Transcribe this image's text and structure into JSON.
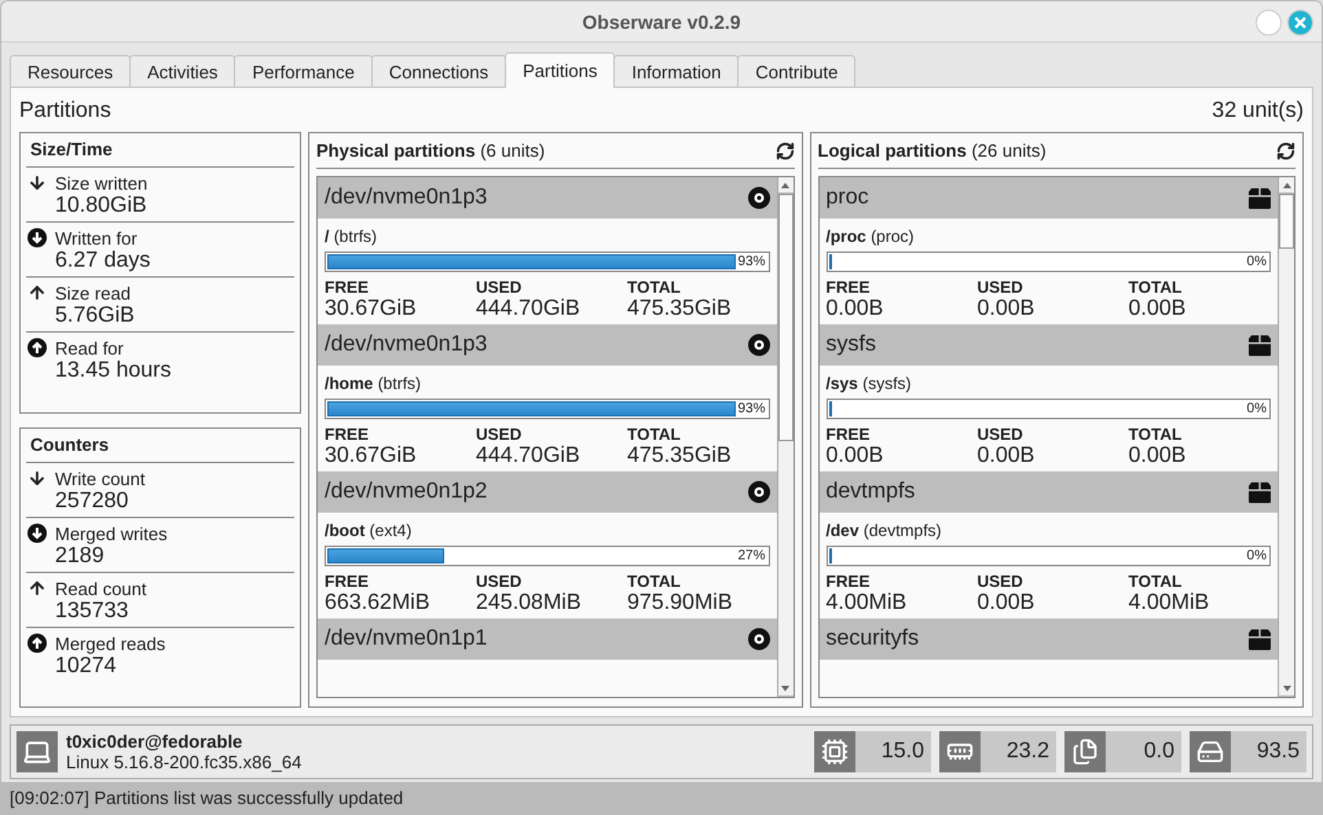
{
  "window": {
    "title": "Obserware v0.2.9"
  },
  "tabs": [
    {
      "label": "Resources",
      "selected": false
    },
    {
      "label": "Activities",
      "selected": false
    },
    {
      "label": "Performance",
      "selected": false
    },
    {
      "label": "Connections",
      "selected": false
    },
    {
      "label": "Partitions",
      "selected": true
    },
    {
      "label": "Information",
      "selected": false
    },
    {
      "label": "Contribute",
      "selected": false
    }
  ],
  "page": {
    "title": "Partitions",
    "unit_count": "32 unit(s)"
  },
  "stat_groups": [
    {
      "title": "Size/Time",
      "items": [
        {
          "kind": "down",
          "label": "Size written",
          "value": "10.80GiB"
        },
        {
          "kind": "down-circle",
          "label": "Written for",
          "value": "6.27 days"
        },
        {
          "kind": "up",
          "label": "Size read",
          "value": "5.76GiB"
        },
        {
          "kind": "up-circle",
          "label": "Read for",
          "value": "13.45 hours"
        }
      ]
    },
    {
      "title": "Counters",
      "items": [
        {
          "kind": "down",
          "label": "Write count",
          "value": "257280"
        },
        {
          "kind": "down-circle",
          "label": "Merged writes",
          "value": "2189"
        },
        {
          "kind": "up",
          "label": "Read count",
          "value": "135733"
        },
        {
          "kind": "up-circle",
          "label": "Merged reads",
          "value": "10274"
        }
      ]
    }
  ],
  "partition_panels": [
    {
      "title": "**Physical partitions** (6 units)",
      "kind": "physical",
      "items": [
        {
          "device": "/dev/nvme0n1p3",
          "mount": "/",
          "fstype": "(btrfs)",
          "level": 0.93,
          "percent": "93%",
          "labels": [
            "FREE",
            "USED",
            "TOTAL"
          ],
          "free": "30.67GiB",
          "used": "444.70GiB",
          "total": "475.35GiB"
        },
        {
          "device": "/dev/nvme0n1p3",
          "mount": "/home",
          "fstype": "(btrfs)",
          "level": 0.93,
          "percent": "93%",
          "labels": [
            "FREE",
            "USED",
            "TOTAL"
          ],
          "free": "30.67GiB",
          "used": "444.70GiB",
          "total": "475.35GiB"
        },
        {
          "device": "/dev/nvme0n1p2",
          "mount": "/boot",
          "fstype": "(ext4)",
          "level": 0.27,
          "percent": "27%",
          "labels": [
            "FREE",
            "USED",
            "TOTAL"
          ],
          "free": "663.62MiB",
          "used": "245.08MiB",
          "total": "975.90MiB"
        },
        {
          "device": "/dev/nvme0n1p1"
        }
      ]
    },
    {
      "title": "**Logical partitions** (26 units)",
      "kind": "logical",
      "items": [
        {
          "device": "proc",
          "mount": "/proc",
          "fstype": "(proc)",
          "level": 0,
          "percent": "0%",
          "labels": [
            "FREE",
            "USED",
            "TOTAL"
          ],
          "free": "0.00B",
          "used": "0.00B",
          "total": "0.00B"
        },
        {
          "device": "sysfs",
          "mount": "/sys",
          "fstype": "(sysfs)",
          "level": 0,
          "percent": "0%",
          "labels": [
            "FREE",
            "USED",
            "TOTAL"
          ],
          "free": "0.00B",
          "used": "0.00B",
          "total": "0.00B"
        },
        {
          "device": "devtmpfs",
          "mount": "/dev",
          "fstype": "(devtmpfs)",
          "level": 0,
          "percent": "0%",
          "labels": [
            "FREE",
            "USED",
            "TOTAL"
          ],
          "free": "4.00MiB",
          "used": "0.00B",
          "total": "4.00MiB"
        },
        {
          "device": "securityfs"
        }
      ]
    }
  ],
  "host": {
    "name": "t0xic0der@fedorable",
    "kernel": "Linux 5.16.8-200.fc35.x86_64"
  },
  "meters": [
    {
      "kind": "cpu",
      "reading": "15.0"
    },
    {
      "kind": "memory",
      "reading": "23.2"
    },
    {
      "kind": "swap",
      "reading": "0.0"
    },
    {
      "kind": "disk",
      "reading": "93.5"
    }
  ],
  "status_bar": "[09:02:07] Partitions list was successfully updated"
}
